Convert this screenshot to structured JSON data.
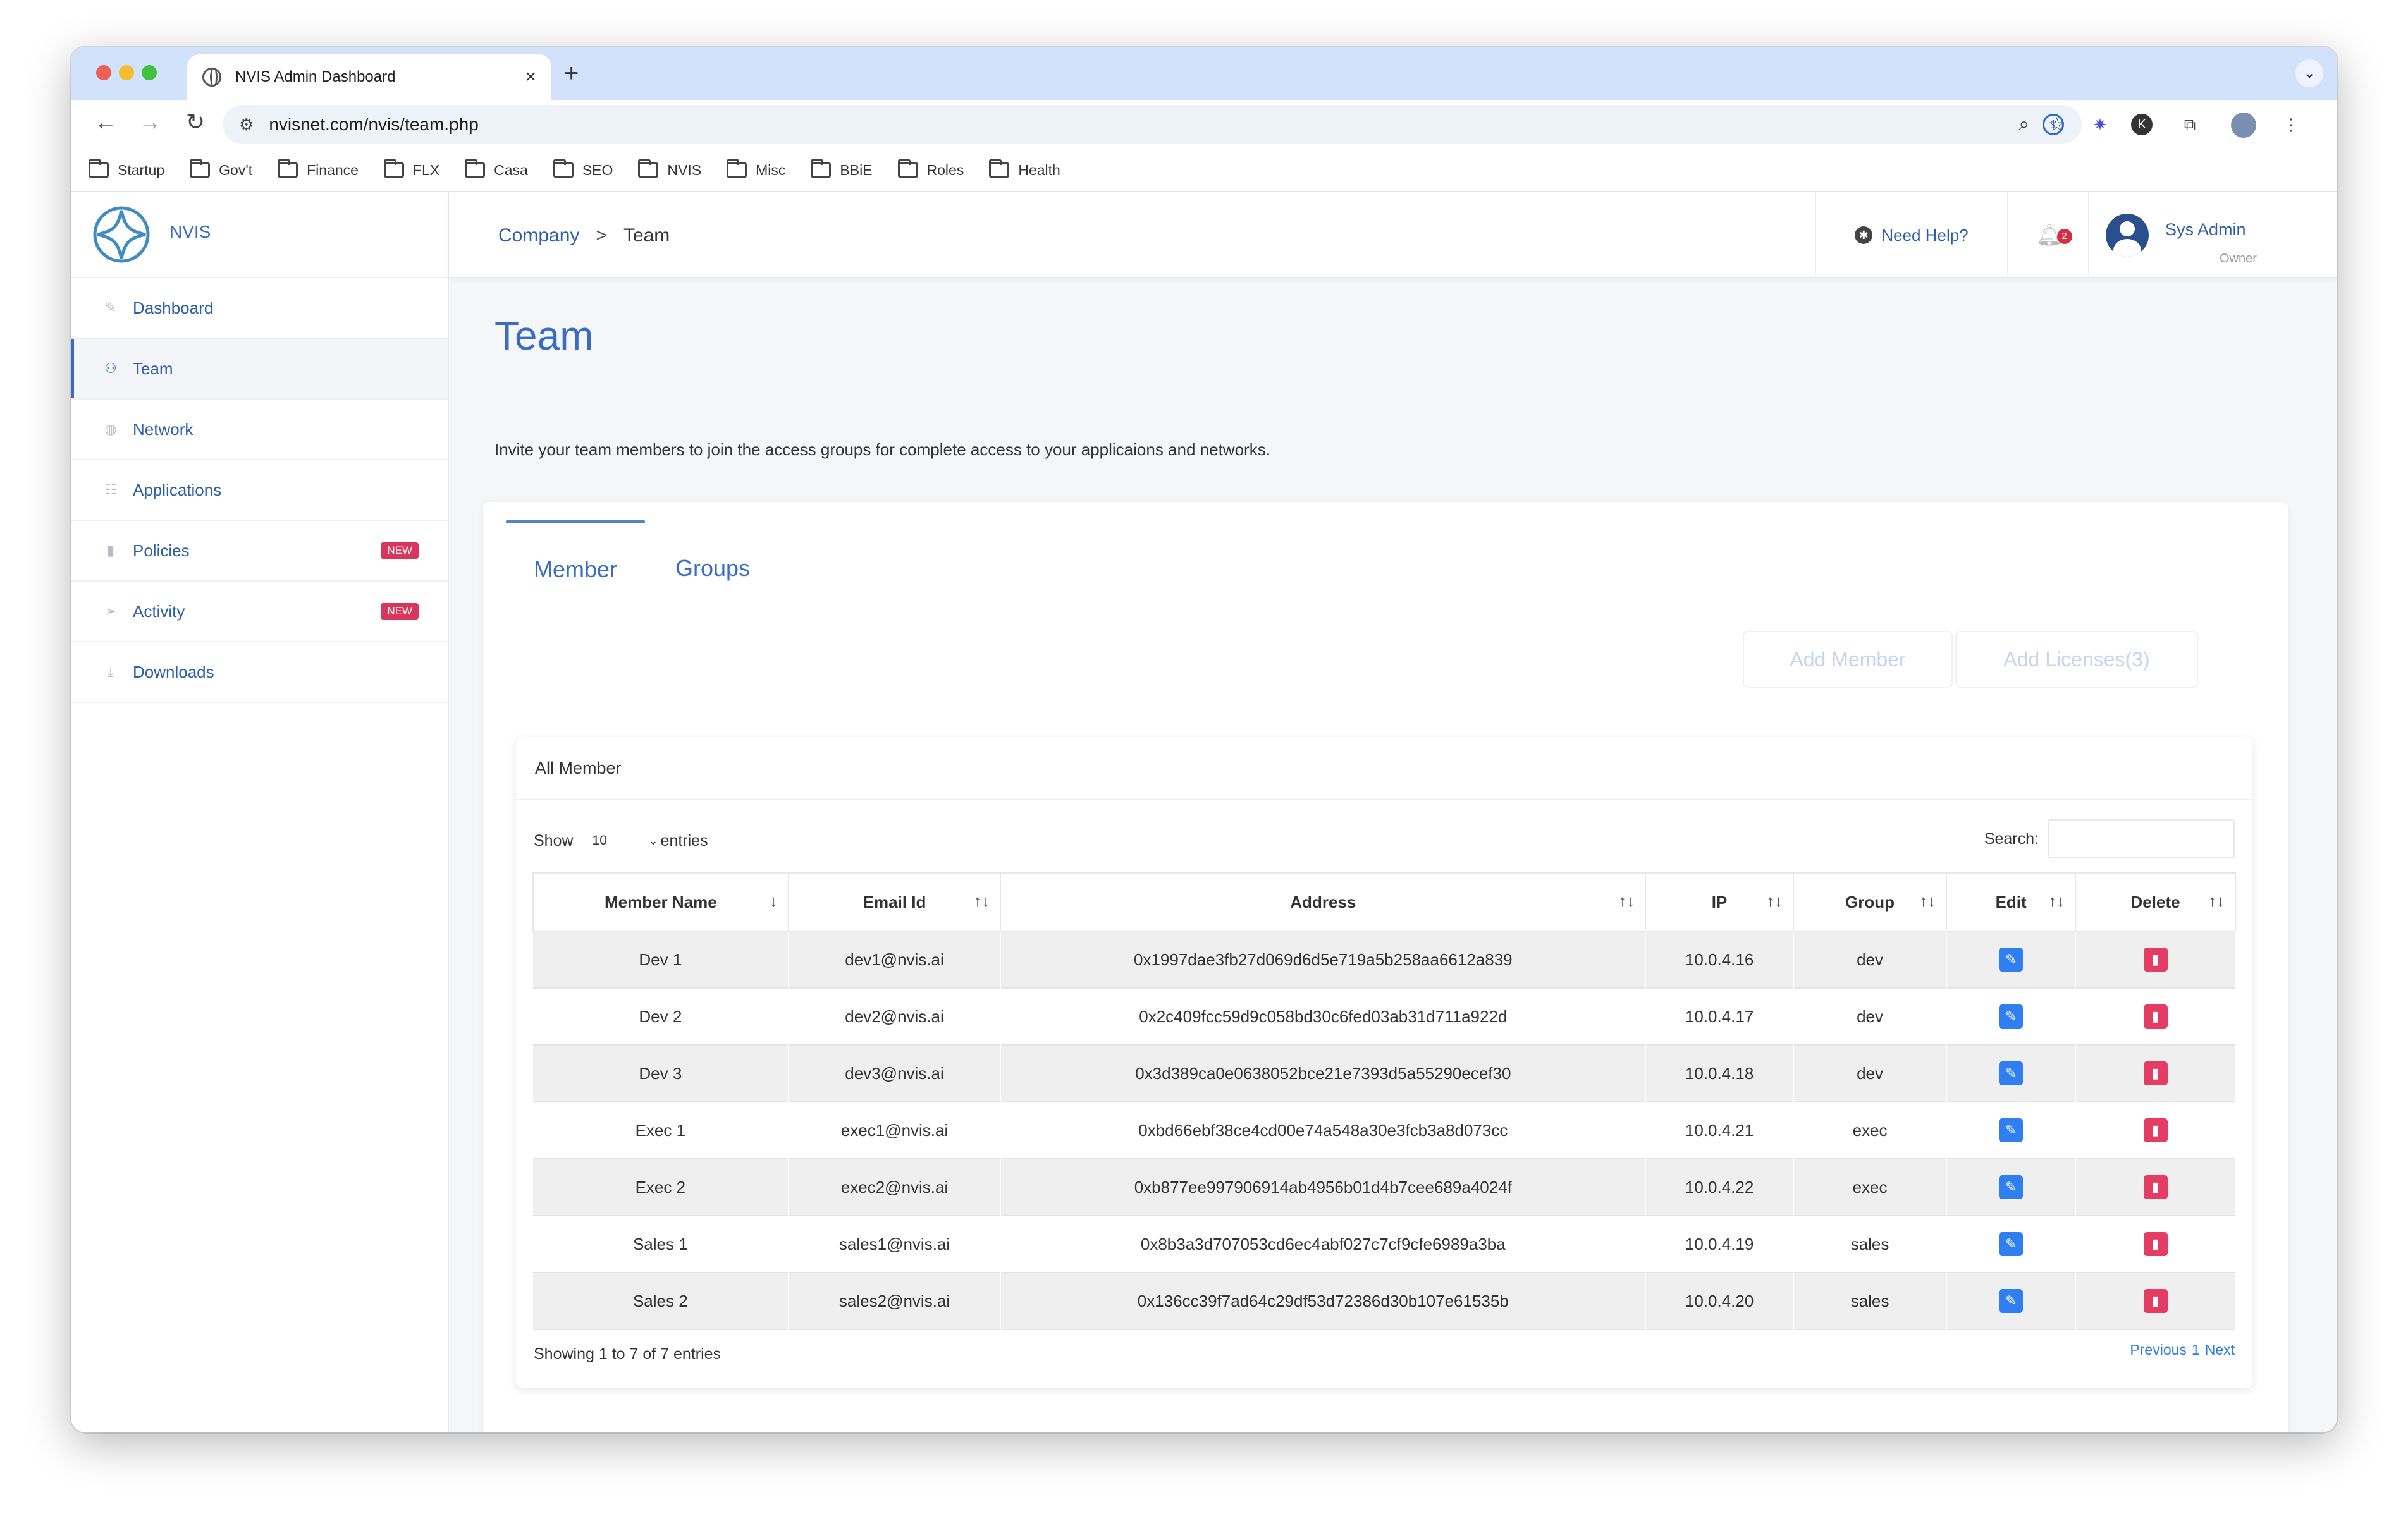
{
  "browser": {
    "tab_title": "NVIS Admin Dashboard",
    "tab_close": "×",
    "new_tab": "+",
    "url": "nvisnet.com/nvis/team.php",
    "bookmarks": [
      "Startup",
      "Gov't",
      "Finance",
      "FLX",
      "Casa",
      "SEO",
      "NVIS",
      "Misc",
      "BBiE",
      "Roles",
      "Health"
    ]
  },
  "sidebar": {
    "brand": "NVIS",
    "items": [
      {
        "label": "Dashboard",
        "icon": "pencil-icon",
        "glyph": "✎",
        "badge": ""
      },
      {
        "label": "Team",
        "icon": "users-icon",
        "glyph": "⚇",
        "badge": ""
      },
      {
        "label": "Network",
        "icon": "globe-icon",
        "glyph": "◍",
        "badge": ""
      },
      {
        "label": "Applications",
        "icon": "list-icon",
        "glyph": "☷",
        "badge": ""
      },
      {
        "label": "Policies",
        "icon": "bookmark-icon",
        "glyph": "▮",
        "badge": "NEW"
      },
      {
        "label": "Activity",
        "icon": "send-icon",
        "glyph": "➢",
        "badge": "NEW"
      },
      {
        "label": "Downloads",
        "icon": "download-icon",
        "glyph": "⤓",
        "badge": ""
      }
    ]
  },
  "topbar": {
    "breadcrumb": {
      "parent": "Company",
      "separator": ">",
      "current": "Team"
    },
    "help": "Need Help?",
    "notifications": "2",
    "user_name": "Sys Admin",
    "user_role": "Owner"
  },
  "page": {
    "title": "Team",
    "subtitle": "Invite your team members to join the access groups for complete access to your applicaions and networks."
  },
  "tabs": {
    "member": "Member",
    "groups": "Groups"
  },
  "actions": {
    "add_member": "Add Member",
    "add_licenses": "Add Licenses(3)"
  },
  "table": {
    "heading": "All Member",
    "show_label": "Show",
    "page_size": "10",
    "entries_label": "entries",
    "search_label": "Search:",
    "columns": [
      "Member Name",
      "Email Id",
      "Address",
      "IP",
      "Group",
      "Edit",
      "Delete"
    ],
    "rows": [
      {
        "name": "Dev 1",
        "email": "dev1@nvis.ai",
        "address": "0x1997dae3fb27d069d6d5e719a5b258aa6612a839",
        "ip": "10.0.4.16",
        "group": "dev"
      },
      {
        "name": "Dev 2",
        "email": "dev2@nvis.ai",
        "address": "0x2c409fcc59d9c058bd30c6fed03ab31d711a922d",
        "ip": "10.0.4.17",
        "group": "dev"
      },
      {
        "name": "Dev 3",
        "email": "dev3@nvis.ai",
        "address": "0x3d389ca0e0638052bce21e7393d5a55290ecef30",
        "ip": "10.0.4.18",
        "group": "dev"
      },
      {
        "name": "Exec 1",
        "email": "exec1@nvis.ai",
        "address": "0xbd66ebf38ce4cd00e74a548a30e3fcb3a8d073cc",
        "ip": "10.0.4.21",
        "group": "exec"
      },
      {
        "name": "Exec 2",
        "email": "exec2@nvis.ai",
        "address": "0xb877ee997906914ab4956b01d4b7cee689a4024f",
        "ip": "10.0.4.22",
        "group": "exec"
      },
      {
        "name": "Sales 1",
        "email": "sales1@nvis.ai",
        "address": "0x8b3a3d707053cd6ec4abf027c7cf9cfe6989a3ba",
        "ip": "10.0.4.19",
        "group": "sales"
      },
      {
        "name": "Sales 2",
        "email": "sales2@nvis.ai",
        "address": "0x136cc39f7ad64c29df53d72386d30b107e61535b",
        "ip": "10.0.4.20",
        "group": "sales"
      }
    ],
    "info": "Showing 1 to 7 of 7 entries",
    "pager": {
      "previous": "Previous",
      "page": "1",
      "next": "Next"
    }
  },
  "colors": {
    "accent": "#3a6cc0",
    "edit": "#2f7ff0",
    "delete": "#e43c62",
    "badge": "#d9365e"
  }
}
